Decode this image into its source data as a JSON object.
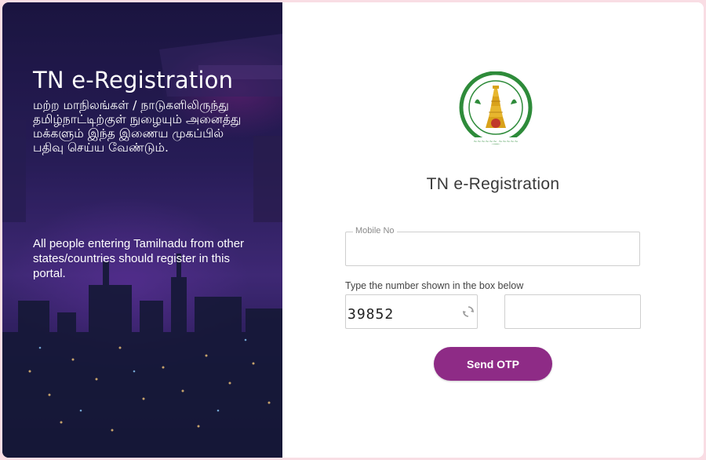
{
  "left_panel": {
    "title": "TN e-Registration",
    "tamil_text": "மற்ற மாநிலங்கள் / நாடுகளிலிருந்து தமிழ்நாட்டிற்குள் நுழையும் அனைத்து மக்களும் இந்த இணைய முகப்பில் பதிவு செய்ய வேண்டும்.",
    "english_text": "All people entering Tamilnadu from other states/countries should register in this portal."
  },
  "form": {
    "title": "TN e-Registration",
    "mobile_legend": "Mobile No",
    "mobile_value": "",
    "captcha_label": "Type the number shown in the box below",
    "captcha_code": "39852",
    "captcha_input_value": "",
    "submit_label": "Send OTP"
  },
  "colors": {
    "accent": "#8e2b86",
    "emblem_green": "#2e8b3a",
    "emblem_gold": "#d9a21b",
    "page_border": "#f9dde4"
  },
  "icons": {
    "emblem": "tamil-nadu-emblem-icon",
    "refresh": "refresh-icon"
  }
}
